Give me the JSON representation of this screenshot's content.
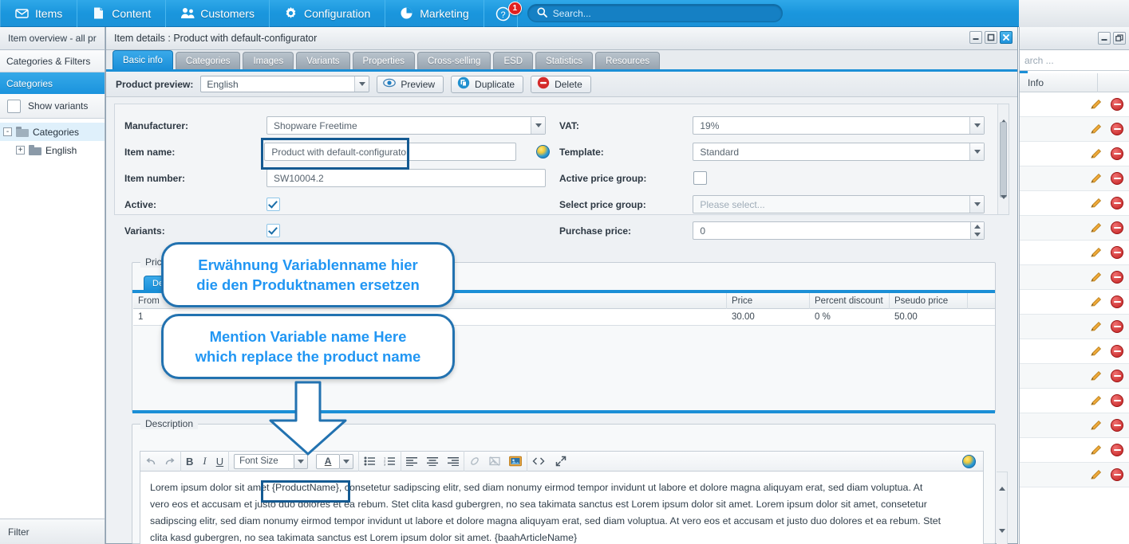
{
  "topnav": {
    "items": [
      {
        "label": "Items",
        "icon": "inbox-icon"
      },
      {
        "label": "Content",
        "icon": "document-icon"
      },
      {
        "label": "Customers",
        "icon": "users-icon"
      },
      {
        "label": "Configuration",
        "icon": "gear-icon"
      },
      {
        "label": "Marketing",
        "icon": "pie-chart-icon"
      }
    ],
    "help_icon": "help-icon",
    "notification_count": "1",
    "search_placeholder": "Search...",
    "search_value": "",
    "brand_icon": "shopware-logo-icon"
  },
  "sidebar": {
    "window_title": "Item overview - all pr",
    "section_title": "Categories & Filters",
    "section_active": "Categories",
    "show_variants_label": "Show variants",
    "show_variants_checked": false,
    "tree": [
      {
        "label": "Categories",
        "expander": "-",
        "level": 0
      },
      {
        "label": "English",
        "expander": "+",
        "level": 1
      }
    ],
    "filter_label": "Filter"
  },
  "window": {
    "title": "Item details : Product with default-configurator",
    "buttons": {
      "minimize": "—",
      "maximize": "❐",
      "close": "✕"
    },
    "tabs": [
      {
        "label": "Basic info",
        "active": true
      },
      {
        "label": "Categories",
        "active": false
      },
      {
        "label": "Images",
        "active": false
      },
      {
        "label": "Variants",
        "active": false
      },
      {
        "label": "Properties",
        "active": false
      },
      {
        "label": "Cross-selling",
        "active": false
      },
      {
        "label": "ESD",
        "active": false
      },
      {
        "label": "Statistics",
        "active": false
      },
      {
        "label": "Resources",
        "active": false
      }
    ],
    "toolbar": {
      "preview_label": "Product preview:",
      "language_value": "English",
      "preview_button": "Preview",
      "duplicate_button": "Duplicate",
      "delete_button": "Delete"
    }
  },
  "form": {
    "left": [
      {
        "label": "Manufacturer:",
        "value": "Shopware Freetime",
        "type": "select"
      },
      {
        "label": "Item name:",
        "value": "Product with default-configurator",
        "type": "text-globe"
      },
      {
        "label": "Item number:",
        "value": "SW10004.2",
        "type": "text"
      },
      {
        "label": "Active:",
        "value": "",
        "type": "checkbox",
        "checked": true
      },
      {
        "label": "Variants:",
        "value": "",
        "type": "checkbox",
        "checked": true
      }
    ],
    "right": [
      {
        "label": "VAT:",
        "value": "19%",
        "type": "select"
      },
      {
        "label": "Template:",
        "value": "Standard",
        "type": "select"
      },
      {
        "label": "Active price group:",
        "value": "",
        "type": "checkbox",
        "checked": false
      },
      {
        "label": "Select price group:",
        "value": "Please select...",
        "type": "select-placeholder"
      },
      {
        "label": "Purchase price:",
        "value": "0",
        "type": "spinner"
      }
    ]
  },
  "prices": {
    "legend": "Prices",
    "tab_label": "Default",
    "columns": [
      "From",
      "",
      "Price",
      "Percent discount",
      "Pseudo price",
      ""
    ],
    "rows": [
      {
        "from": "1",
        "blank": "",
        "price": "30.00",
        "percent_discount": "0 %",
        "pseudo_price": "50.00"
      }
    ]
  },
  "description": {
    "legend": "Description",
    "toolbar": {
      "undo": "undo-icon",
      "redo": "redo-icon",
      "bold": "B",
      "italic": "I",
      "underline": "U",
      "font_size_label": "Font Size",
      "text_color": "A",
      "bullet_list": "bullet-list-icon",
      "numbered_list": "numbered-list-icon",
      "align_left": "align-left-icon",
      "align_center": "align-center-icon",
      "align_right": "align-right-icon",
      "unlink": "unlink-icon",
      "remove_image": "remove-image-icon",
      "insert_media": "insert-media-icon",
      "source_code": "source-code-icon",
      "fullscreen": "fullscreen-icon",
      "globe": "globe-icon"
    },
    "body_lines": [
      "Lorem ipsum dolor sit amet {ProductName}, consetetur sadipscing elitr, sed diam nonumy eirmod tempor invidunt ut labore et dolore magna aliquyam erat, sed diam voluptua. At",
      "vero eos et accusam et justo duo dolores et ea rebum. Stet clita kasd gubergren, no sea takimata sanctus est Lorem ipsum dolor sit amet. Lorem ipsum dolor sit amet, consetetur",
      "sadipscing elitr, sed diam nonumy eirmod tempor invidunt ut labore et dolore magna aliquyam erat, sed diam voluptua. At vero eos et accusam et justo duo dolores et ea rebum. Stet",
      "clita kasd gubergren, no sea takimata sanctus est Lorem ipsum dolor sit amet. {baahArticleName}"
    ],
    "highlighted_variable": "{ProductName}"
  },
  "callouts": [
    {
      "line1": "Erwähnung Variablenname hier",
      "line2": "die den Produktnamen ersetzen",
      "lang": "de"
    },
    {
      "line1": "Mention Variable name Here",
      "line2": "which replace the product name",
      "lang": "en"
    }
  ],
  "right_panel": {
    "search_placeholder": "arch ...",
    "column_header": "Info",
    "rows": [
      {
        "edit": "pencil-icon",
        "delete": "delete-icon"
      },
      {
        "edit": "pencil-icon",
        "delete": "delete-icon"
      },
      {
        "edit": "pencil-icon",
        "delete": "delete-icon"
      },
      {
        "edit": "pencil-icon",
        "delete": "delete-icon"
      },
      {
        "edit": "pencil-icon",
        "delete": "delete-icon"
      },
      {
        "edit": "pencil-icon",
        "delete": "delete-icon"
      },
      {
        "edit": "pencil-icon",
        "delete": "delete-icon"
      },
      {
        "edit": "pencil-icon",
        "delete": "delete-icon"
      },
      {
        "edit": "pencil-icon",
        "delete": "delete-icon"
      },
      {
        "edit": "pencil-icon",
        "delete": "delete-icon"
      },
      {
        "edit": "pencil-icon",
        "delete": "delete-icon"
      },
      {
        "edit": "pencil-icon",
        "delete": "delete-icon"
      },
      {
        "edit": "pencil-icon",
        "delete": "delete-icon"
      },
      {
        "edit": "pencil-icon",
        "delete": "delete-icon"
      },
      {
        "edit": "pencil-icon",
        "delete": "delete-icon"
      },
      {
        "edit": "pencil-icon",
        "delete": "delete-icon"
      }
    ]
  },
  "colors": {
    "accent_blue": "#1b8fd6",
    "nav_blue": "#1a96dd",
    "callout_border": "#2272b0",
    "callout_text": "#2196f3",
    "highlight_box": "#145a92",
    "badge_red": "#e02020",
    "delete_red": "#c22020"
  }
}
